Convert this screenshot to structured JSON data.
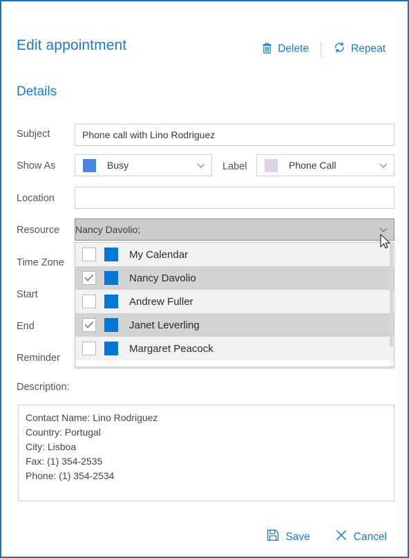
{
  "window": {
    "border_color": "#1572c0",
    "accent_color": "#1979d2"
  },
  "header": {
    "title": "Edit appointment",
    "delete_label": "Delete",
    "delete_icon": "trash-icon",
    "repeat_label": "Repeat",
    "repeat_icon": "repeat-icon"
  },
  "details": {
    "section_title": "Details",
    "rows": {
      "subject": {
        "label": "Subject",
        "value": "Phone call with Lino Rodriguez",
        "placeholder": ""
      },
      "show_as": {
        "label": "Show As",
        "value": "Busy",
        "swatch_color": "#4a86e0"
      },
      "label_field": {
        "label": "Label",
        "value": "Phone Call",
        "swatch_color": "#ddd0e8"
      },
      "location": {
        "label": "Location",
        "value": "",
        "placeholder": ""
      },
      "resource": {
        "label": "Resource",
        "value": "Nancy Davolio;",
        "expanded": "true"
      },
      "time_zone": {
        "label": "Time Zone",
        "value": ""
      },
      "start": {
        "label": "Start",
        "value": ""
      },
      "end": {
        "label": "End",
        "value": ""
      },
      "reminder": {
        "label": "Reminder",
        "value": ""
      }
    }
  },
  "resource_dropdown": {
    "items": [
      {
        "label": "My Calendar",
        "checked": false,
        "color": "#0078d4"
      },
      {
        "label": "Nancy Davolio",
        "checked": true,
        "color": "#0078d4"
      },
      {
        "label": "Andrew Fuller",
        "checked": false,
        "color": "#0078d4"
      },
      {
        "label": "Janet Leverling",
        "checked": true,
        "color": "#0078d4"
      },
      {
        "label": "Margaret Peacock",
        "checked": false,
        "color": "#0078d4"
      }
    ]
  },
  "description": {
    "label": "Description:",
    "lines": [
      "Contact Name: Lino Rodriguez",
      "Country: Portugal",
      "City: Lisboa",
      "Fax: (1) 354-2535",
      "Phone: (1) 354-2534"
    ]
  },
  "footer": {
    "save_label": "Save",
    "save_icon": "save-disk-icon",
    "cancel_label": "Cancel",
    "cancel_icon": "close-x-icon"
  }
}
